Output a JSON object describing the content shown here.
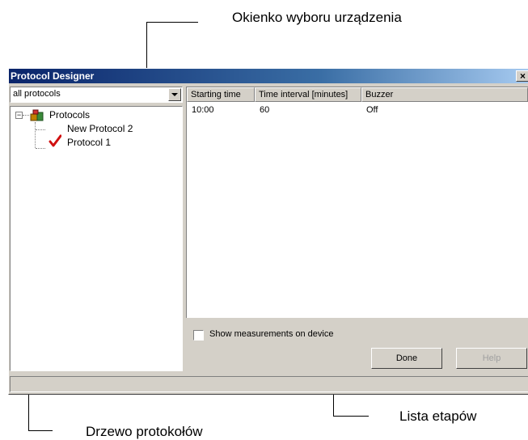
{
  "callouts": {
    "device_selector": "Okienko wyboru urządzenia",
    "step_list": "Lista etapów",
    "protocol_tree": "Drzewo protokołów"
  },
  "window": {
    "title": "Protocol Designer",
    "close_label": "×"
  },
  "dropdown": {
    "selected": "all protocols"
  },
  "tree": {
    "root_label": "Protocols",
    "items": [
      {
        "label": "New Protocol 2",
        "active": false
      },
      {
        "label": "Protocol 1",
        "active": true
      }
    ]
  },
  "list": {
    "columns": [
      "Starting time",
      "Time interval [minutes]",
      "Buzzer"
    ],
    "rows": [
      [
        "10:00",
        "60",
        "Off"
      ]
    ]
  },
  "options": {
    "show_measurements_label": "Show measurements on device",
    "show_measurements_checked": false
  },
  "buttons": {
    "done": "Done",
    "help": "Help"
  },
  "icons": {
    "root": "protocols-folder-icon",
    "active_marker": "red-checkmark-icon"
  }
}
